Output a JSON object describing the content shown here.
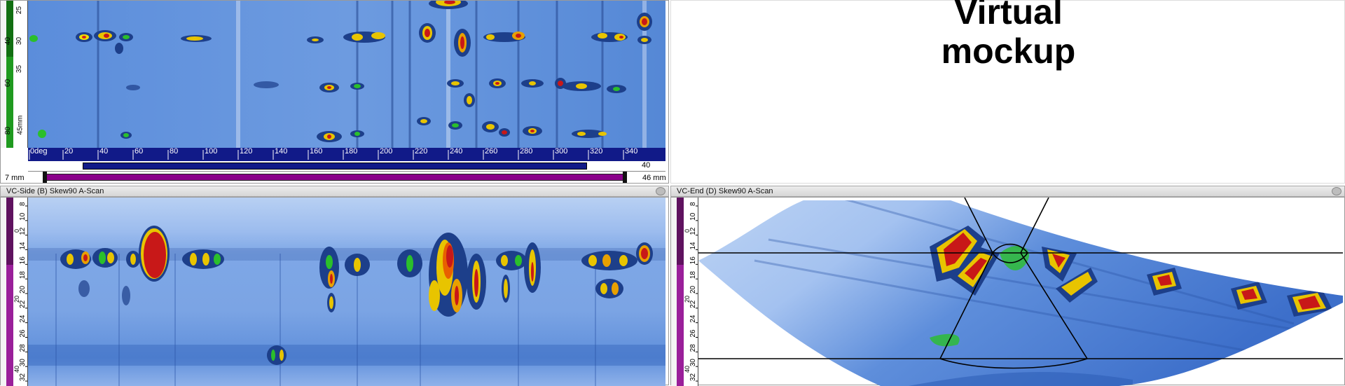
{
  "top_right": {
    "title_line1": "Virtual",
    "title_line2": "mockup"
  },
  "top_left": {
    "depth_labels": [
      "25",
      "40",
      "30",
      "60",
      "35",
      "80",
      "45mm"
    ],
    "ruler_labels": [
      "0deg",
      "20",
      "40",
      "60",
      "80",
      "100",
      "120",
      "140",
      "160",
      "180",
      "200",
      "220",
      "240",
      "260",
      "280",
      "300",
      "320",
      "340"
    ],
    "ruler_end_value": "40",
    "scroll_min": "7 mm",
    "scroll_max": "46 mm"
  },
  "bottom_left": {
    "title": "VC-Side (B) Skew90 A-Scan",
    "scale_labels": [
      "8",
      "10",
      "12",
      "14",
      "16",
      "18",
      "20",
      "22",
      "24",
      "26",
      "28",
      "30",
      "32"
    ],
    "green_scale_labels": [
      "0",
      "20",
      "40"
    ]
  },
  "bottom_right": {
    "title": "VC-End (D) Skew90 A-Scan",
    "scale_labels": [
      "8",
      "10",
      "12",
      "14",
      "16",
      "18",
      "20",
      "22",
      "24",
      "26",
      "28",
      "30",
      "32"
    ],
    "green_scale_labels": [
      "0",
      "20",
      "40"
    ]
  },
  "colors": {
    "scan_blue": "#4d7fd6",
    "scan_light": "#a9c6f0",
    "ruler_navy": "#111a88",
    "scale_green": "#1f9a1f",
    "scale_purple": "#9a1f9a",
    "scrollbar_purple": "#8a008a"
  }
}
